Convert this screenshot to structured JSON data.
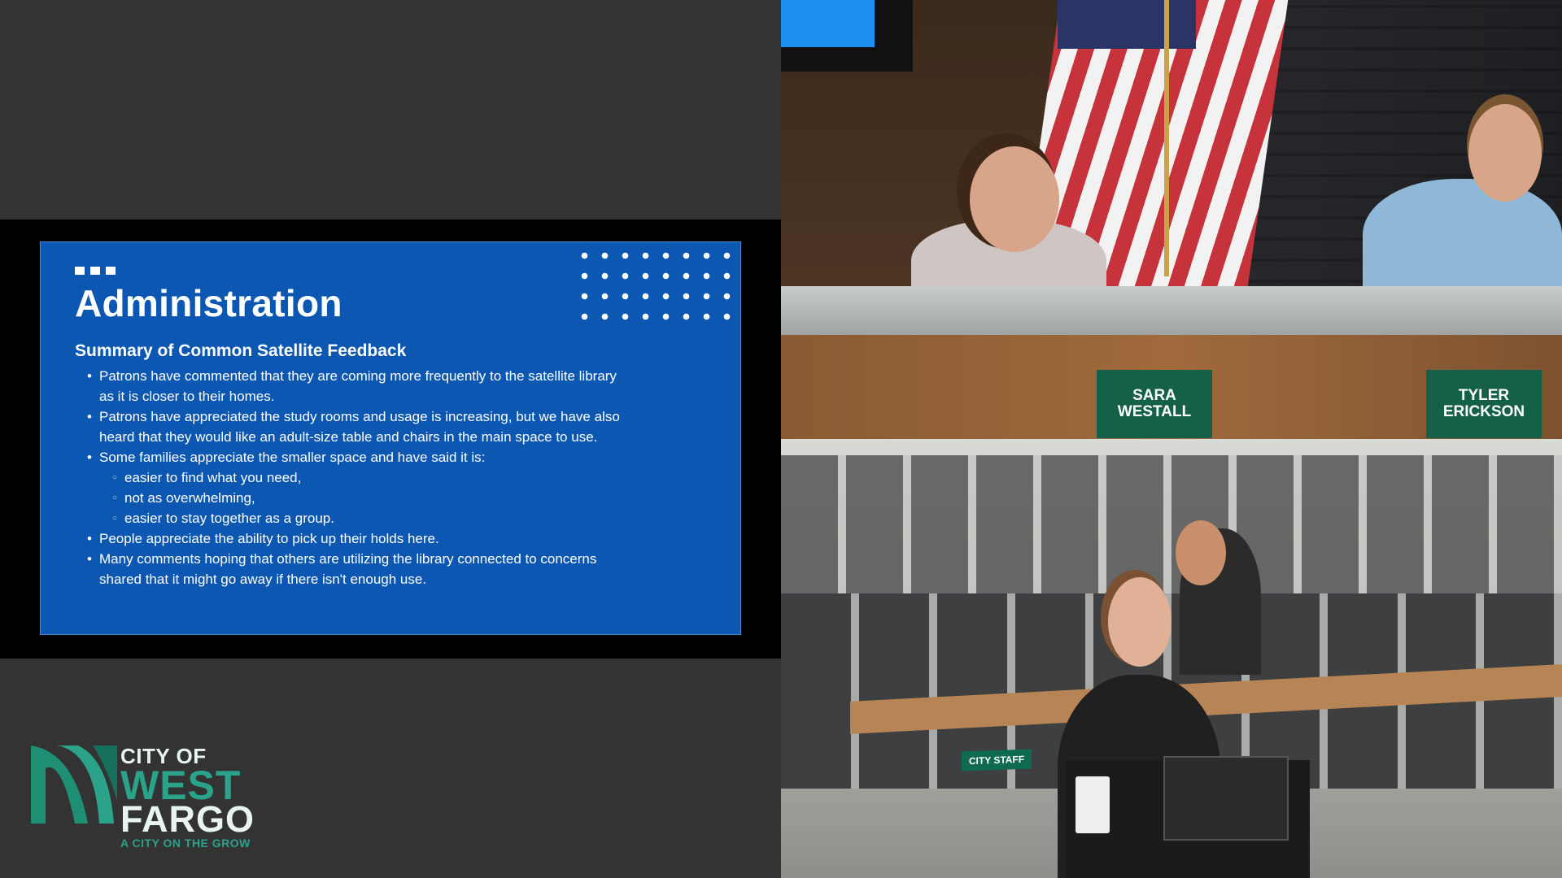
{
  "slide": {
    "title": "Administration",
    "subtitle": "Summary of Common Satellite Feedback",
    "items": [
      {
        "level": 1,
        "text": "Patrons have commented that they are coming more frequently to the satellite library"
      },
      {
        "level": 1,
        "cont": true,
        "text": "as it is closer to their homes."
      },
      {
        "level": 1,
        "text": "Patrons have appreciated the study rooms and usage is increasing, but we have also"
      },
      {
        "level": 1,
        "cont": true,
        "text": "heard that they would like an adult-size table and chairs in the main space to use."
      },
      {
        "level": 1,
        "text": "Some families appreciate the smaller space and have said it is:"
      },
      {
        "level": 2,
        "text": "easier to find what you need,"
      },
      {
        "level": 2,
        "text": "not as overwhelming,"
      },
      {
        "level": 2,
        "text": "easier to stay together as a group."
      },
      {
        "level": 1,
        "text": "People appreciate the ability to pick up their holds here."
      },
      {
        "level": 1,
        "text": "Many comments hoping that others are utilizing the library connected to concerns"
      },
      {
        "level": 1,
        "cont": true,
        "text": "shared that it might go away if there isn't enough use."
      }
    ]
  },
  "logo": {
    "city_of": "CITY OF",
    "west": "WEST",
    "fargo": "FARGO",
    "tagline": "A CITY ON THE GROW"
  },
  "camera_top": {
    "nameplates": [
      "SARA\nWESTALL",
      "TYLER\nERICKSON"
    ]
  },
  "camera_bottom": {
    "sign": "CITY STAFF"
  },
  "colors": {
    "background": "#333333",
    "slide_blue": "#0b57b2",
    "brand_green": "#2aa38a",
    "nameplate_green": "#156049"
  }
}
